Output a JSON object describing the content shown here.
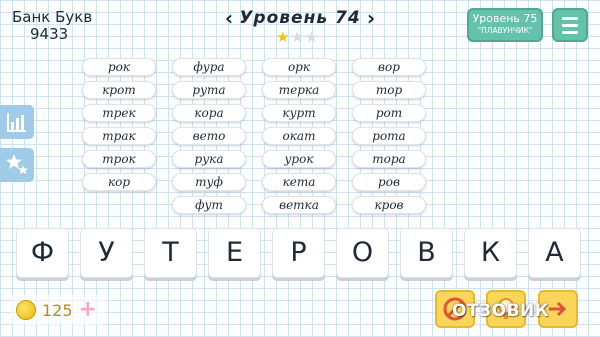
{
  "header": {
    "bank_label": "Банк Букв",
    "bank_count": "9433",
    "level_title": "Уровень 74",
    "prev_arrow": "‹",
    "next_arrow": "›",
    "stars": {
      "filled": 1,
      "total": 3,
      "star_glyph": "★"
    },
    "next_level": {
      "line1": "Уровень 75",
      "line2": "\"ПЛАВУНЧИК\""
    },
    "menu_icon": "hamburger-icon"
  },
  "sidebar": {
    "buttons": [
      {
        "name": "stats-button",
        "icon": "bar-chart-icon"
      },
      {
        "name": "achievements-button",
        "icon": "stars-icon"
      }
    ]
  },
  "words": {
    "col1": [
      "рок",
      "крот",
      "трек",
      "трак",
      "трок",
      "кор"
    ],
    "col2": [
      "фура",
      "рута",
      "кора",
      "вето",
      "рука",
      "туф",
      "фут"
    ],
    "col3": [
      "орк",
      "терка",
      "курт",
      "окат",
      "урок",
      "кета",
      "ветка"
    ],
    "col4": [
      "вор",
      "тор",
      "рот",
      "рота",
      "тора",
      "ров",
      "кров"
    ]
  },
  "letters": [
    "Ф",
    "У",
    "Т",
    "Е",
    "Р",
    "О",
    "В",
    "К",
    "А"
  ],
  "coins": {
    "count": "125",
    "add": "+",
    "icon": "coin-icon"
  },
  "hints": [
    {
      "name": "hint-button-1",
      "icon": "crossed-letter-icon"
    },
    {
      "name": "hint-button-2",
      "icon": "lightbulb-icon"
    },
    {
      "name": "hint-button-3",
      "icon": "arrow-icon"
    }
  ],
  "watermark": "ОТЗОВИК",
  "colors": {
    "accent": "#64c2aa",
    "side": "#9fcbe9",
    "hint": "#f9d65a",
    "star": "#f2c21a"
  }
}
